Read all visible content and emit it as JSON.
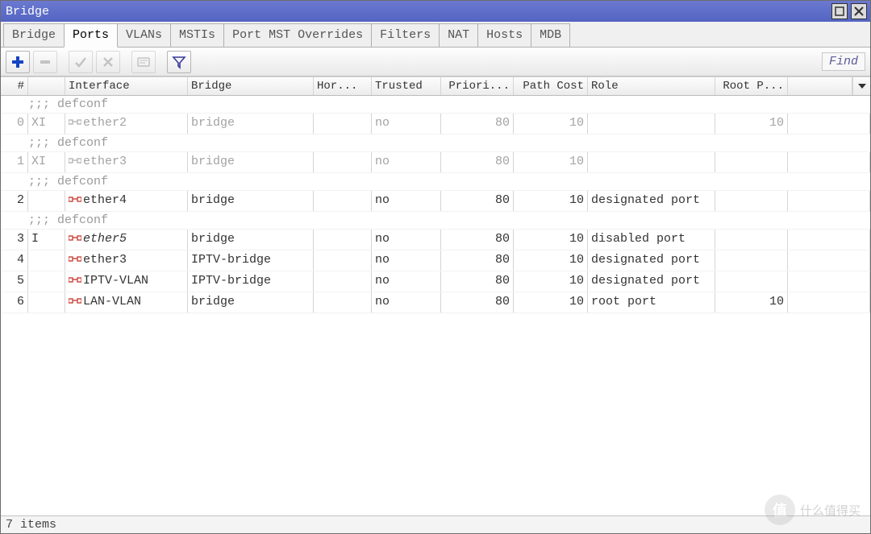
{
  "title": "Bridge",
  "tabs": [
    "Bridge",
    "Ports",
    "VLANs",
    "MSTIs",
    "Port MST Overrides",
    "Filters",
    "NAT",
    "Hosts",
    "MDB"
  ],
  "active_tab": 1,
  "find_label": "Find",
  "columns": {
    "num": "#",
    "flag": "",
    "iface": "Interface",
    "bridge": "Bridge",
    "hor": "Hor...",
    "trusted": "Trusted",
    "priority": "Priori...",
    "pathcost": "Path Cost",
    "role": "Role",
    "rootp": "Root P..."
  },
  "rows": [
    {
      "type": "comment",
      "text": ";;; defconf"
    },
    {
      "type": "data",
      "dim": true,
      "num": "0",
      "flag": "XI",
      "iface": "ether2",
      "bridge": "bridge",
      "hor": "",
      "trusted": "no",
      "priority": "80",
      "pathcost": "10",
      "role": "",
      "rootp": "10"
    },
    {
      "type": "comment",
      "text": ";;; defconf"
    },
    {
      "type": "data",
      "dim": true,
      "num": "1",
      "flag": "XI",
      "iface": "ether3",
      "bridge": "bridge",
      "hor": "",
      "trusted": "no",
      "priority": "80",
      "pathcost": "10",
      "role": "",
      "rootp": ""
    },
    {
      "type": "comment",
      "text": ";;; defconf"
    },
    {
      "type": "data",
      "dim": false,
      "num": "2",
      "flag": "",
      "iface": "ether4",
      "bridge": "bridge",
      "hor": "",
      "trusted": "no",
      "priority": "80",
      "pathcost": "10",
      "role": "designated port",
      "rootp": ""
    },
    {
      "type": "comment",
      "text": ";;; defconf"
    },
    {
      "type": "data",
      "dim": false,
      "num": "3",
      "flag": "I",
      "iface": "ether5",
      "bridge": "bridge",
      "hor": "",
      "trusted": "no",
      "priority": "80",
      "pathcost": "10",
      "role": "disabled port",
      "rootp": "",
      "italic": true
    },
    {
      "type": "data",
      "dim": false,
      "num": "4",
      "flag": "",
      "iface": "ether3",
      "bridge": "IPTV-bridge",
      "hor": "",
      "trusted": "no",
      "priority": "80",
      "pathcost": "10",
      "role": "designated port",
      "rootp": ""
    },
    {
      "type": "data",
      "dim": false,
      "num": "5",
      "flag": "",
      "iface": "IPTV-VLAN",
      "bridge": "IPTV-bridge",
      "hor": "",
      "trusted": "no",
      "priority": "80",
      "pathcost": "10",
      "role": "designated port",
      "rootp": ""
    },
    {
      "type": "data",
      "dim": false,
      "num": "6",
      "flag": "",
      "iface": "LAN-VLAN",
      "bridge": "bridge",
      "hor": "",
      "trusted": "no",
      "priority": "80",
      "pathcost": "10",
      "role": "root port",
      "rootp": "10"
    }
  ],
  "status": "7 items",
  "watermark": "什么值得买"
}
